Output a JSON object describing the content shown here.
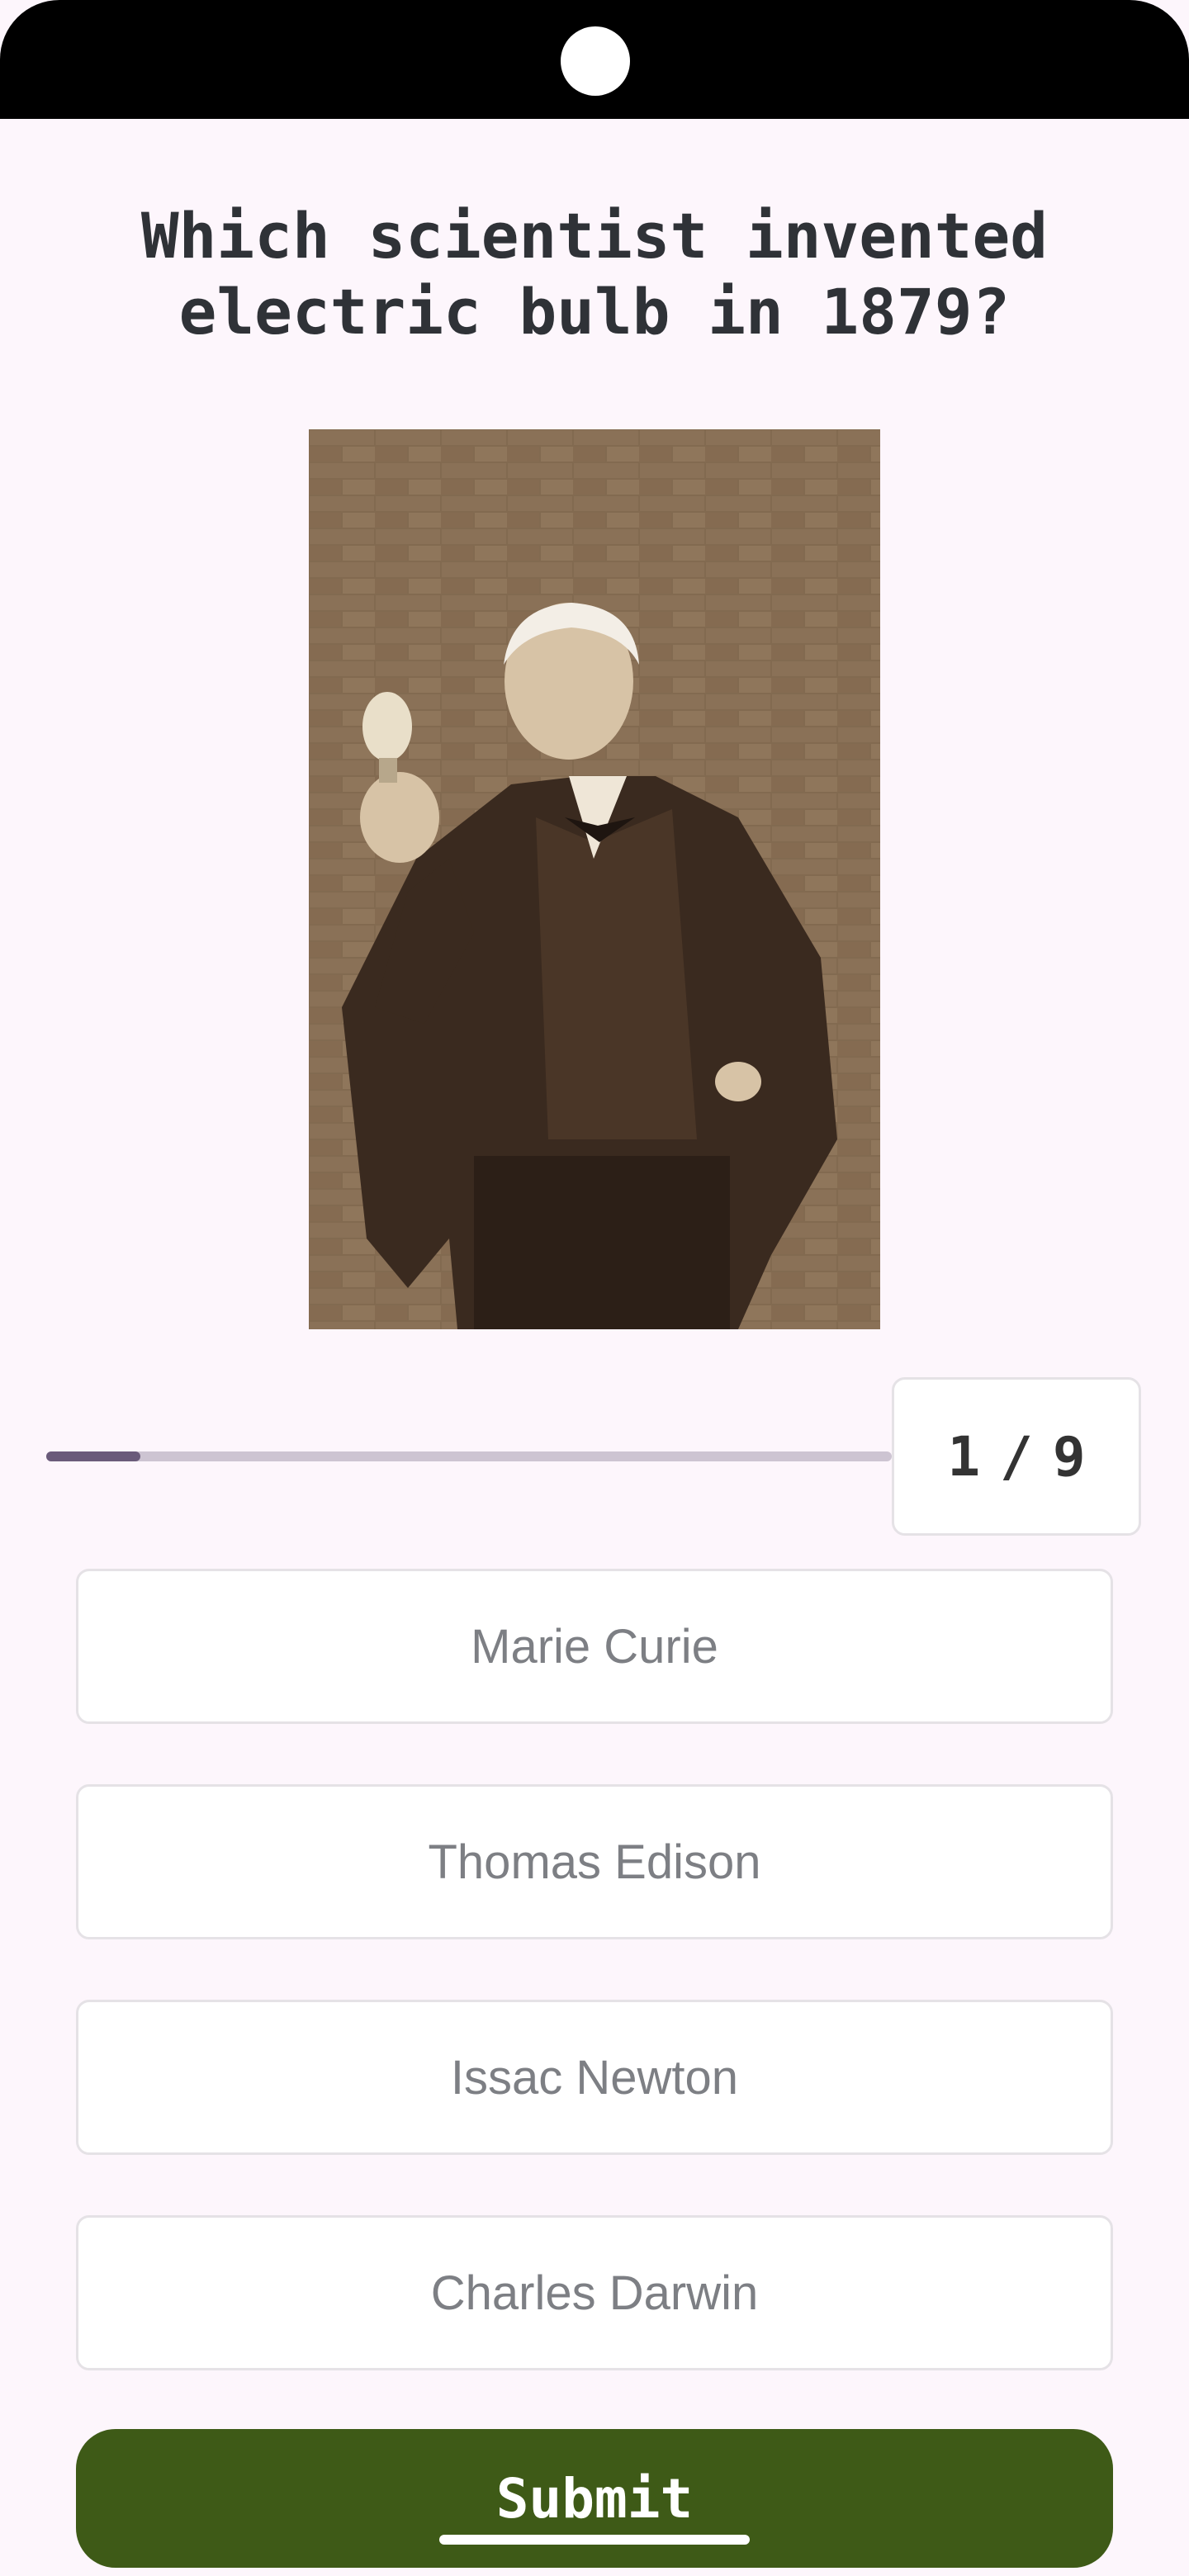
{
  "question": {
    "text": "Which scientist invented electric bulb in 1879?"
  },
  "image": {
    "alt": "Thomas Edison holding a light bulb"
  },
  "progress": {
    "current": "1",
    "separator": "/",
    "total": "9",
    "fraction": 0.111
  },
  "options": [
    {
      "label": "Marie Curie"
    },
    {
      "label": "Thomas Edison"
    },
    {
      "label": "Issac Newton"
    },
    {
      "label": "Charles Darwin"
    }
  ],
  "submit": {
    "label": "Submit"
  },
  "colors": {
    "background": "#fdf6fc",
    "progress_fill": "#6a5b7a",
    "progress_track": "#cdc4d2",
    "submit_button": "#3e5a17"
  }
}
